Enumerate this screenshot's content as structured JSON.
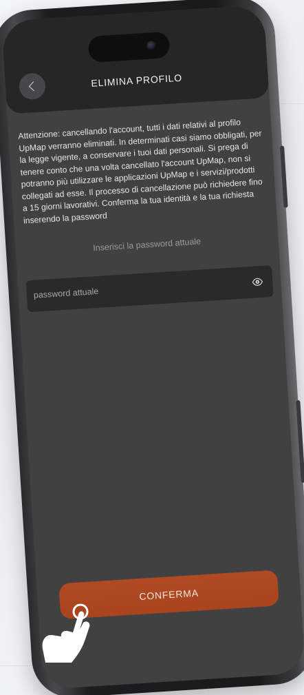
{
  "header": {
    "title": "ELIMINA PROFILO",
    "back_icon": "chevron-left-icon"
  },
  "main": {
    "warning": "Attenzione: cancellando l'account, tutti i dati relativi al profilo UpMap verranno eliminati. In determinati casi siamo obbligati, per la legge vigente, a conservare i tuoi dati personali. Si prega di tenere conto che una volta cancellato l'account UpMap, non si potranno più utilizzare le applicazioni UpMap e i servizi/prodotti collegati ad esse. Il processo di cancellazione può richiedere fino a 15 giorni lavorativi. Conferma la tua identità e la tua richiesta inserendo la password",
    "password_prompt": "Inserisci la password attuale",
    "password_field": {
      "placeholder": "password attuale",
      "value": "",
      "toggle_icon": "eye-icon"
    },
    "confirm_button": {
      "label": "CONFERMA"
    }
  },
  "overlay": {
    "pointer_icon": "hand-pointer-icon"
  },
  "colors": {
    "screen_background": "#414142",
    "top_bar": "#262626",
    "input_background": "#2a2a2b",
    "accent_button": "#ab4621",
    "text_primary": "#e6e6e6",
    "text_secondary": "#9a9a9a"
  }
}
